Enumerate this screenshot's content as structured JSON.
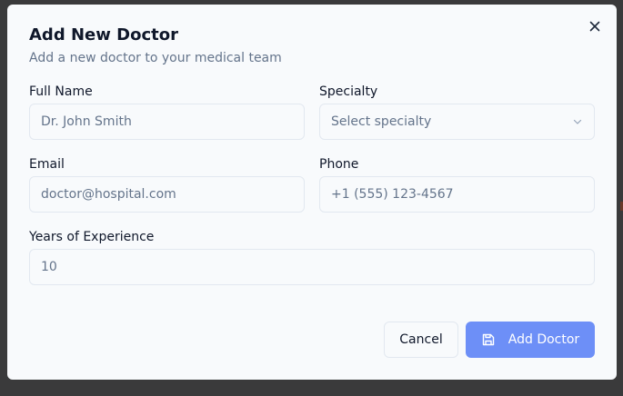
{
  "dialog": {
    "title": "Add New Doctor",
    "subtitle": "Add a new doctor to your medical team",
    "close_icon": "close-icon"
  },
  "form": {
    "full_name": {
      "label": "Full Name",
      "placeholder": "Dr. John Smith",
      "value": ""
    },
    "specialty": {
      "label": "Specialty",
      "placeholder": "Select specialty",
      "icon": "chevron-down-icon"
    },
    "email": {
      "label": "Email",
      "placeholder": "doctor@hospital.com",
      "value": ""
    },
    "phone": {
      "label": "Phone",
      "placeholder": "+1 (555) 123-4567",
      "value": ""
    },
    "experience": {
      "label": "Years of Experience",
      "placeholder": "10",
      "value": ""
    }
  },
  "actions": {
    "cancel_label": "Cancel",
    "add_label": "Add Doctor",
    "add_icon": "save-icon"
  },
  "colors": {
    "primary": "#6d8ff7",
    "backdrop": "#3a3a3b",
    "surface": "#f8fafc",
    "border": "#e2e8f0",
    "muted_text": "#64748b"
  }
}
